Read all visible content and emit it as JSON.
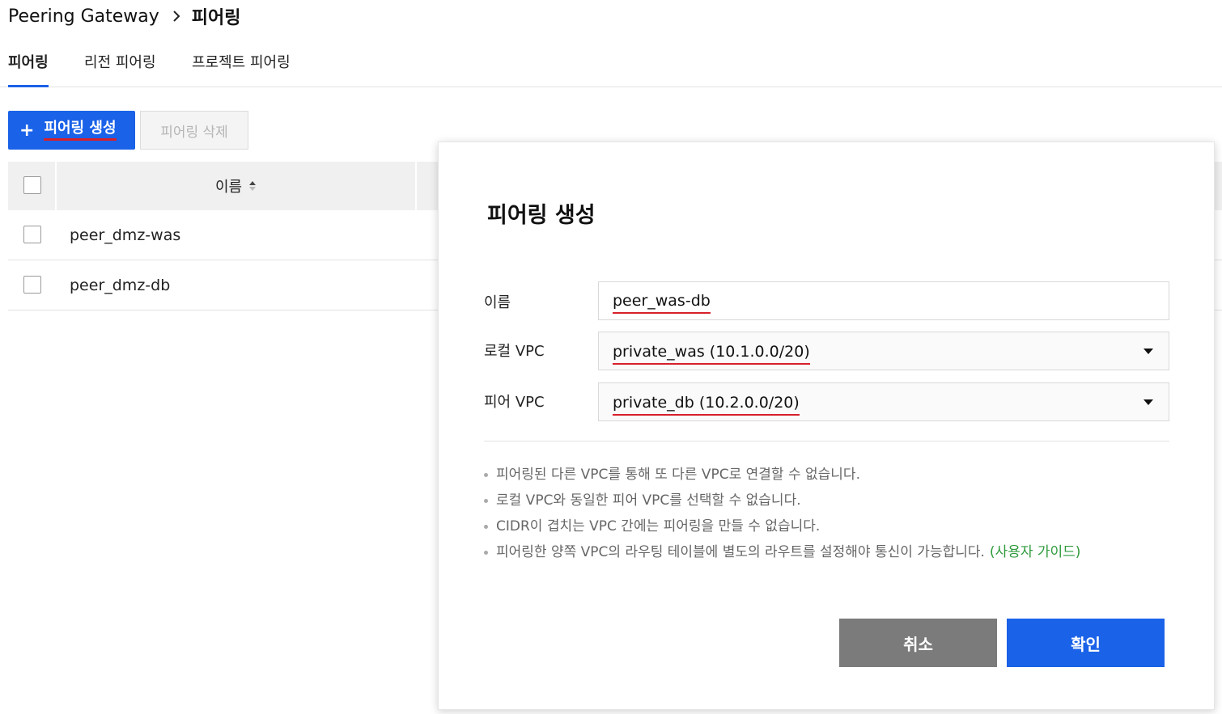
{
  "breadcrumb": {
    "parent": "Peering Gateway",
    "current": "피어링"
  },
  "tabs": [
    {
      "label": "피어링",
      "active": true
    },
    {
      "label": "리전 피어링",
      "active": false
    },
    {
      "label": "프로젝트 피어링",
      "active": false
    }
  ],
  "toolbar": {
    "create_label": "피어링 생성",
    "create_icon": "plus-icon",
    "delete_label": "피어링 삭제"
  },
  "table": {
    "columns": [
      "이름"
    ],
    "sort_icon": "sort-asc-icon",
    "rows": [
      {
        "name": "peer_dmz-was"
      },
      {
        "name": "peer_dmz-db"
      }
    ]
  },
  "modal": {
    "title": "피어링 생성",
    "fields": {
      "name_label": "이름",
      "name_value": "peer_was-db",
      "local_vpc_label": "로컬 VPC",
      "local_vpc_value": "private_was (10.1.0.0/20)",
      "peer_vpc_label": "피어 VPC",
      "peer_vpc_value": "private_db (10.2.0.0/20)"
    },
    "notes": [
      "피어링된 다른 VPC를 통해 또 다른 VPC로 연결할 수 없습니다.",
      "로컬 VPC와 동일한 피어 VPC를 선택할 수 없습니다.",
      "CIDR이 겹치는 VPC 간에는 피어링을 만들 수 없습니다.",
      "피어링한 양쪽 VPC의 라우팅 테이블에 별도의 라우트를 설정해야 통신이 가능합니다."
    ],
    "guide_link": "(사용자 가이드)",
    "cancel_label": "취소",
    "ok_label": "확인"
  },
  "colors": {
    "primary": "#1a62e8",
    "annotation": "#d7202a",
    "guide_link": "#2e9a3c",
    "cancel_bg": "#7b7b7b"
  }
}
